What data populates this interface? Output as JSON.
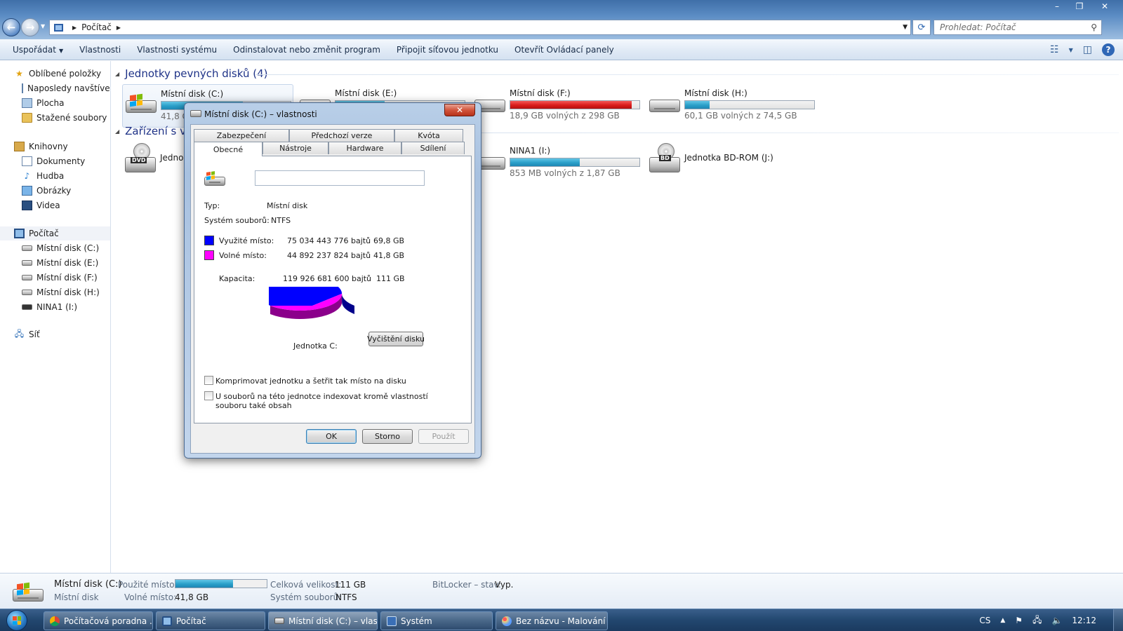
{
  "window": {
    "caption_minimize": "–",
    "caption_restore": "❐",
    "caption_close": "✕"
  },
  "address": {
    "crumb": "Počítač",
    "search_placeholder": "Prohledat: Počítač"
  },
  "toolbar": {
    "organize": "Uspořádat",
    "properties": "Vlastnosti",
    "system_properties": "Vlastnosti systému",
    "uninstall": "Odinstalovat nebo změnit program",
    "map_drive": "Připojit síťovou jednotku",
    "control_panel": "Otevřít Ovládací panely",
    "help": "?"
  },
  "nav": {
    "favorites": "Oblíbené položky",
    "recent": "Naposledy navštívené",
    "desktop": "Plocha",
    "downloads": "Stažené soubory",
    "libraries": "Knihovny",
    "documents": "Dokumenty",
    "music": "Hudba",
    "pictures": "Obrázky",
    "videos": "Videa",
    "computer": "Počítač",
    "drive_c": "Místní disk (C:)",
    "drive_e": "Místní disk (E:)",
    "drive_f": "Místní disk (F:)",
    "drive_h": "Místní disk (H:)",
    "drive_i": "NINA1 (I:)",
    "network": "Síť"
  },
  "groups": {
    "hard_drives": "Jednotky pevných disků (4)",
    "removable": "Zařízení s vy"
  },
  "drives": {
    "c": {
      "name": "Místní disk (C:)",
      "free_partial": "41,8 G",
      "used_fraction": 0.63
    },
    "e": {
      "name": "Místní disk (E:)",
      "used_fraction": 0.38
    },
    "f": {
      "name": "Místní disk (F:)",
      "free": "18,9 GB volných z 298 GB",
      "used_fraction": 0.94
    },
    "h": {
      "name": "Místní disk (H:)",
      "free": "60,1 GB volných z 74,5 GB",
      "used_fraction": 0.19
    },
    "dvd": {
      "name_partial": "Jedno",
      "badge": "DVD"
    },
    "nina": {
      "name": "NINA1 (I:)",
      "free": "853 MB volných z 1,87 GB",
      "used_fraction": 0.54
    },
    "bd": {
      "name": "Jednotka BD-ROM (J:)",
      "badge": "BD"
    }
  },
  "details": {
    "name": "Místní disk (C:)",
    "type": "Místní disk",
    "used_label": "Použité místo:",
    "free_label": "Volné místo:",
    "free_value": "41,8 GB",
    "total_label": "Celková velikost:",
    "total_value": "111 GB",
    "fs_label": "Systém souborů:",
    "fs_value": "NTFS",
    "bitlocker_label": "BitLocker – stav:",
    "bitlocker_value": "Vyp.",
    "used_fraction": 0.63
  },
  "dialog": {
    "title": "Místní disk (C:) – vlastnosti",
    "close": "✕",
    "tabs_row1": [
      "Zabezpečení",
      "Předchozí verze",
      "Kvóta"
    ],
    "tabs_row2": [
      "Obecné",
      "Nástroje",
      "Hardware",
      "Sdílení"
    ],
    "type_label": "Typ:",
    "type_value": "Místní disk",
    "fs_label": "Systém souborů:",
    "fs_value": "NTFS",
    "used_label": "Využité místo:",
    "used_bytes": "75 034 443 776 bajtů",
    "used_gb": "69,8 GB",
    "free_label": "Volné místo:",
    "free_bytes": "44 892 237 824 bajtů",
    "free_gb": "41,8 GB",
    "capacity_label": "Kapacita:",
    "capacity_bytes": "119 926 681 600 bajtů",
    "capacity_gb": "111 GB",
    "drive_label": "Jednotka C:",
    "cleanup_button": "Vyčištění disku",
    "compress_label": "Komprimovat jednotku a šetřit tak místo na disku",
    "index_label_1": "U souborů na této jednotce indexovat kromě vlastností",
    "index_label_2": "souboru také obsah",
    "ok": "OK",
    "cancel": "Storno",
    "apply": "Použít",
    "used_color": "#0000ff",
    "free_color": "#ff00ff",
    "used_fraction": 0.626
  },
  "taskbar": {
    "items": [
      "Počítačová poradna ...",
      "Počítač",
      "Místní disk (C:) – vlas...",
      "Systém",
      "Bez názvu - Malování"
    ],
    "lang": "CS",
    "clock": "12:12"
  }
}
